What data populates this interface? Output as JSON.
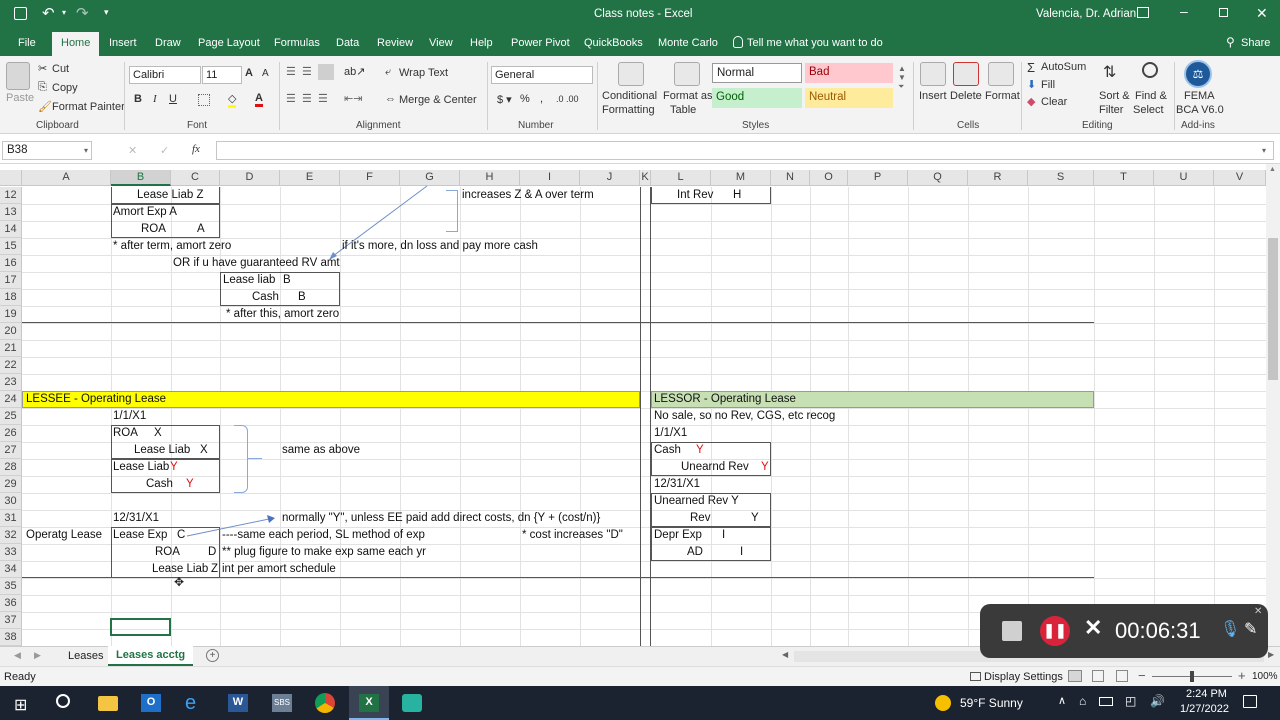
{
  "title_bar": {
    "document_title": "Class notes - Excel",
    "user": "Valencia, Dr. Adrian"
  },
  "tabs": [
    "File",
    "Home",
    "Insert",
    "Draw",
    "Page Layout",
    "Formulas",
    "Data",
    "Review",
    "View",
    "Help",
    "Power Pivot",
    "QuickBooks",
    "Monte Carlo"
  ],
  "tell_me": "Tell me what you want to do",
  "share": "Share",
  "ribbon": {
    "clipboard": {
      "paste": "Paste",
      "cut": "Cut",
      "copy": "Copy",
      "format_painter": "Format Painter",
      "label": "Clipboard"
    },
    "font": {
      "name": "Calibri",
      "size": "11",
      "label": "Font"
    },
    "alignment": {
      "wrap_text": "Wrap Text",
      "merge_center": "Merge & Center",
      "label": "Alignment"
    },
    "number": {
      "format": "General",
      "label": "Number"
    },
    "styles": {
      "conditional": "Conditional",
      "conditional2": "Formatting",
      "format_as": "Format as",
      "format_as2": "Table",
      "normal": "Normal",
      "bad": "Bad",
      "good": "Good",
      "neutral": "Neutral",
      "label": "Styles"
    },
    "cells": {
      "insert": "Insert",
      "delete": "Delete",
      "format": "Format",
      "label": "Cells"
    },
    "editing": {
      "autosum": "AutoSum",
      "fill": "Fill",
      "clear": "Clear",
      "sort": "Sort &",
      "sort2": "Filter",
      "find": "Find &",
      "find2": "Select",
      "label": "Editing"
    },
    "addins": {
      "name": "FEMA",
      "name2": "BCA V6.0",
      "label": "Add-ins"
    }
  },
  "formula_bar": {
    "name_box": "B38",
    "fx": "fx"
  },
  "columns": [
    "A",
    "B",
    "C",
    "D",
    "E",
    "F",
    "G",
    "H",
    "I",
    "J",
    "K",
    "L",
    "M",
    "N",
    "O",
    "P",
    "Q",
    "R",
    "S",
    "T",
    "U",
    "V"
  ],
  "rows": [
    "12",
    "13",
    "14",
    "15",
    "16",
    "17",
    "18",
    "19",
    "20",
    "21",
    "22",
    "23",
    "24",
    "25",
    "26",
    "27",
    "28",
    "29",
    "30",
    "31",
    "32",
    "33",
    "34",
    "35",
    "36",
    "37",
    "38"
  ],
  "cells": {
    "r12_b": "Lease Liab Z",
    "r12_h": "increases Z & A over term",
    "r12_l": "Int Rev",
    "r12_m": "H",
    "r13_b": "Amort Exp A",
    "r14_b": "ROA",
    "r14_c": "A",
    "r15_b": "* after term, amort zero",
    "r15_f": "if it's more, dn loss and pay more cash",
    "r16_c": "OR if u have guaranteed RV amt",
    "r17_d": "Lease liab",
    "r17_e": "B",
    "r18_d": "Cash",
    "r18_e": "B",
    "r19_d": "* after this, amort zero",
    "r24_a": "LESSEE - Operating Lease",
    "r24_l": "LESSOR - Operating Lease",
    "r25_b": "1/1/X1",
    "r25_l": "No sale, so no Rev, CGS, etc recog",
    "r26_b": "ROA",
    "r26_c": "X",
    "r26_l": "1/1/X1",
    "r27_b": "Lease Liab",
    "r27_c": "X",
    "r27_e": "same as above",
    "r27_l": "Cash",
    "r27_m": "Y",
    "r28_b": "Lease Liab",
    "r28_b2": "Y",
    "r28_l": "Unearnd Rev",
    "r28_m": "Y",
    "r29_b": "Cash",
    "r29_c": "Y",
    "r29_l": "12/31/X1",
    "r30_l": "Unearned Rev Y",
    "r31_b": "12/31/X1",
    "r31_e": "normally \"Y\", unless EE paid add direct costs, dn {Y + (cost/n)}",
    "r31_l": "Rev",
    "r31_m": "Y",
    "r32_a": "Operatg Lease",
    "r32_b": "Lease Exp",
    "r32_c": "C",
    "r32_d": "----same each period, SL method of exp",
    "r32_i": "* cost increases \"D\"",
    "r32_l": "Depr Exp",
    "r32_m": "I",
    "r33_c": "ROA",
    "r33_d": "D",
    "r33_d2": "** plug figure to make exp same each yr",
    "r33_l": "AD",
    "r33_m": "I",
    "r34_c": "Lease Liab",
    "r34_d": "Z",
    "r34_d2": "int per amort schedule"
  },
  "sheet_tabs": [
    "Leases",
    "Leases acctg"
  ],
  "status": {
    "ready": "Ready",
    "display_settings": "Display Settings",
    "zoom": "100%"
  },
  "recorder": {
    "time": "00:06:31"
  },
  "taskbar": {
    "weather": "59°F  Sunny",
    "time": "2:24 PM",
    "date": "1/27/2022"
  },
  "colors": {
    "excel_green": "#217346",
    "yellow_band": "#ffff00",
    "green_band": "#c6e0b4",
    "bad": "#ffc7ce",
    "good": "#c6efce",
    "neutral": "#ffeb9c"
  }
}
